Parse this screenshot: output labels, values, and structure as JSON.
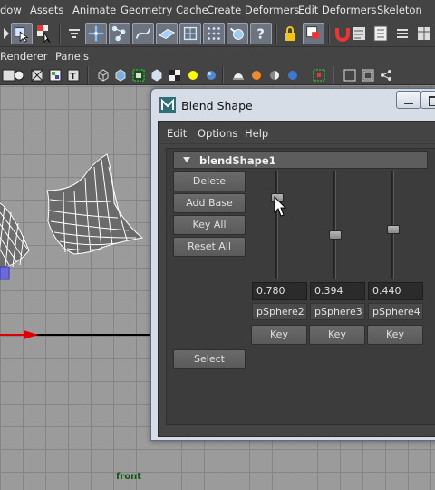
{
  "menubar": {
    "items": [
      "dow",
      "Assets",
      "Animate",
      "Geometry Cache",
      "Create Deformers",
      "Edit Deformers",
      "Skeleton"
    ]
  },
  "toolbar": {
    "icons": [
      "select-tool-icon",
      "lasso-tool-icon",
      "paint-select-icon",
      "sculpt-icon",
      "move-icon",
      "joint-icon",
      "curve-icon",
      "plane-icon",
      "lattice-icon",
      "cluster-icon",
      "rotate-sphere-icon",
      "help-icon",
      "lock-icon",
      "component-icon",
      "magnet-icon",
      "snap-icon",
      "history-icon",
      "attribute-icon",
      "channel-box-icon",
      "toolsettings-icon"
    ]
  },
  "panel_menu": {
    "renderer": "Renderer",
    "panels": "Panels"
  },
  "viewport": {
    "label": "front"
  },
  "blend_window": {
    "title": "Blend Shape",
    "menu": {
      "edit": "Edit",
      "options": "Options",
      "help": "Help"
    },
    "node_name": "blendShape1",
    "buttons": {
      "delete": "Delete",
      "add_base": "Add Base",
      "key_all": "Key All",
      "reset_all": "Reset All",
      "select": "Select"
    },
    "targets": [
      {
        "name": "pSphere2",
        "weight": "0.780",
        "key": "Key"
      },
      {
        "name": "pSphere3",
        "weight": "0.394",
        "key": "Key"
      },
      {
        "name": "pSphere4",
        "weight": "0.440",
        "key": "Key"
      }
    ]
  },
  "colors": {
    "window_bg": "#444444",
    "titlebar": "#d6dde6",
    "viewport": "#9b9b9b",
    "wireframe": "#ffffff"
  }
}
